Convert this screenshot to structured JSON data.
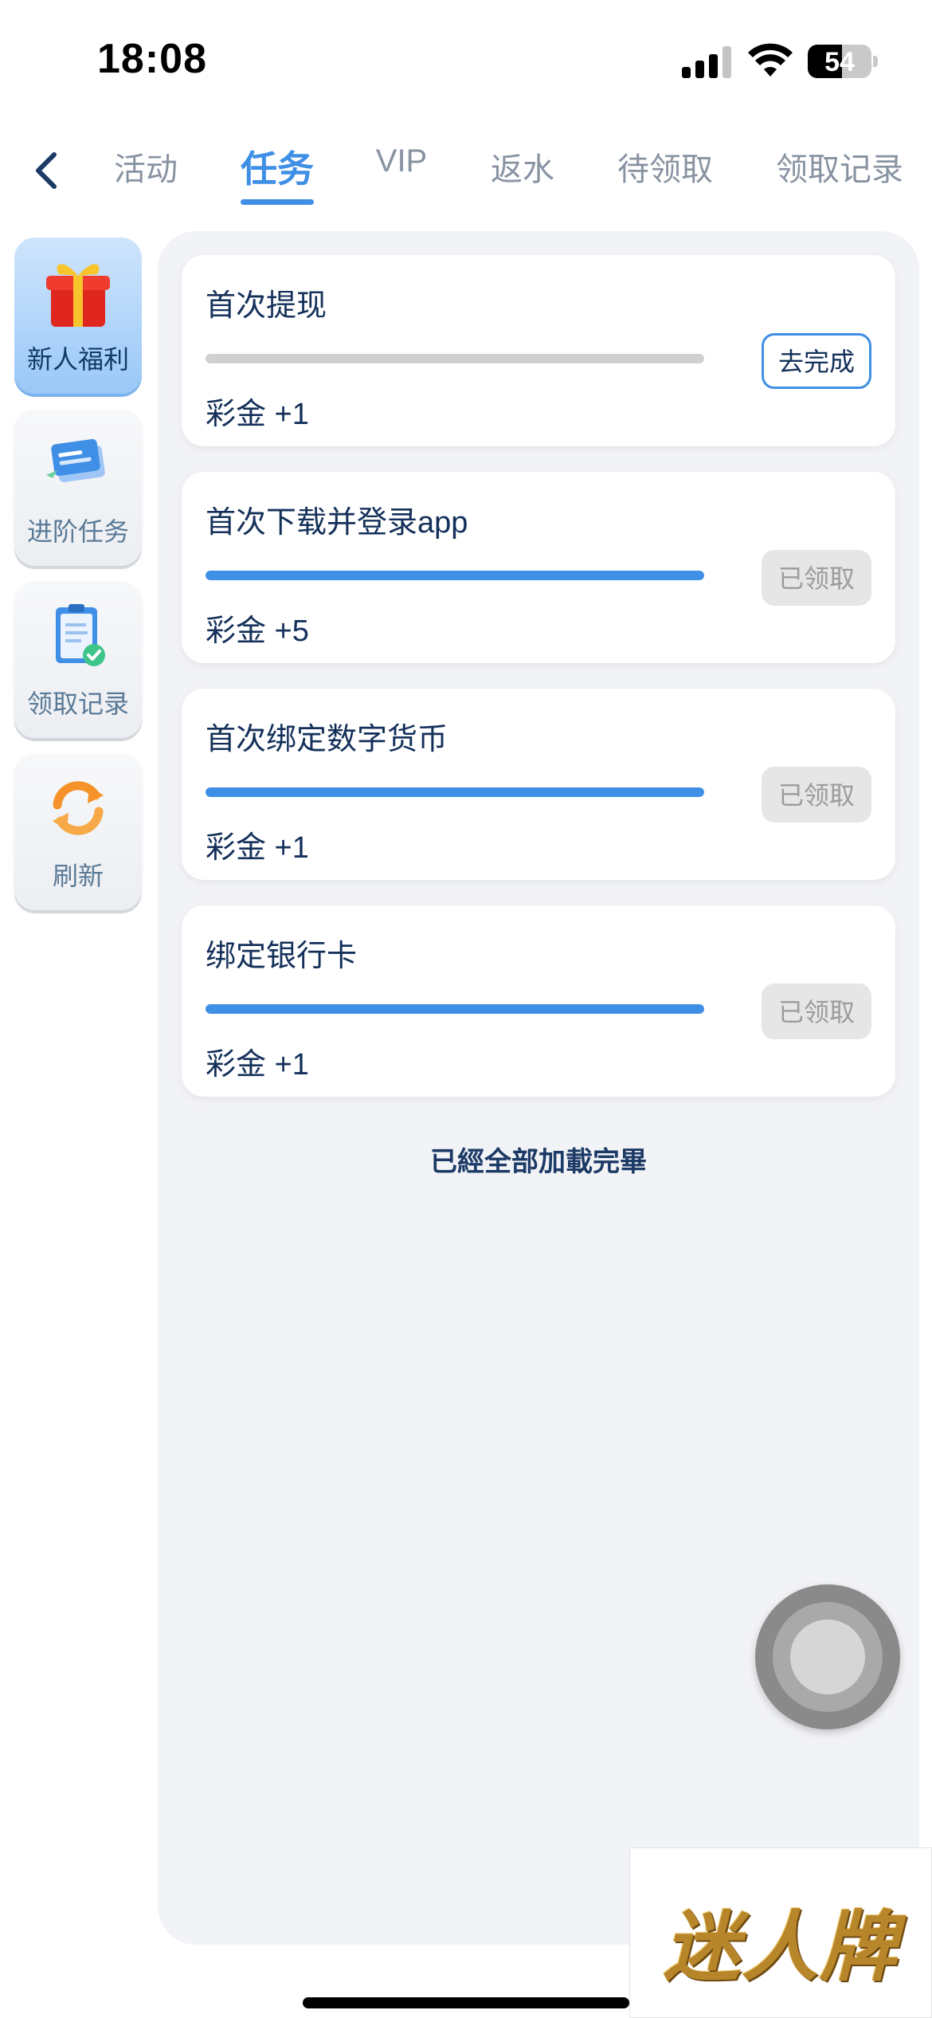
{
  "status_bar": {
    "time": "18:08",
    "battery": "54",
    "signal_bars": 4,
    "signal_bars_filled": 3
  },
  "tabs": [
    {
      "label": "活动",
      "active": false
    },
    {
      "label": "任务",
      "active": true
    },
    {
      "label": "VIP",
      "active": false
    },
    {
      "label": "返水",
      "active": false
    },
    {
      "label": "待领取",
      "active": false
    },
    {
      "label": "领取记录",
      "active": false
    }
  ],
  "sidebar": {
    "items": [
      {
        "label": "新人福利",
        "icon": "gift-icon",
        "active": true
      },
      {
        "label": "进阶任务",
        "icon": "task-cards-icon",
        "active": false
      },
      {
        "label": "领取记录",
        "icon": "clipboard-check-icon",
        "active": false
      },
      {
        "label": "刷新",
        "icon": "refresh-icon",
        "active": false
      }
    ]
  },
  "tasks": [
    {
      "title": "首次提现",
      "reward": "彩金 +1",
      "progress": 0,
      "button": "去完成",
      "status": "go"
    },
    {
      "title": "首次下载并登录app",
      "reward": "彩金 +5",
      "progress": 1,
      "button": "已领取",
      "status": "done"
    },
    {
      "title": "首次绑定数字货币",
      "reward": "彩金 +1",
      "progress": 1,
      "button": "已领取",
      "status": "done"
    },
    {
      "title": "绑定银行卡",
      "reward": "彩金 +1",
      "progress": 1,
      "button": "已领取",
      "status": "done"
    }
  ],
  "list_end_text": "已經全部加載完畢",
  "watermark": "迷人牌",
  "colors": {
    "accent": "#3f8fe6",
    "text_dark": "#14305a",
    "tab_inactive": "#8893a2",
    "panel_bg": "#f2f3f6",
    "button_disabled": "#e6e6e6"
  }
}
